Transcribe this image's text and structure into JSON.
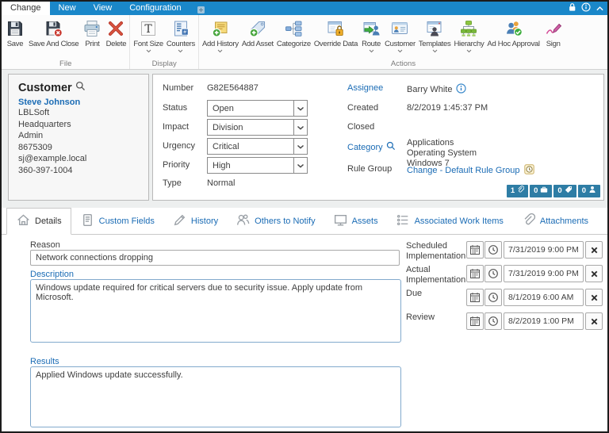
{
  "titlebar": {
    "tabs": [
      {
        "label": "Change"
      },
      {
        "label": "New"
      },
      {
        "label": "View"
      },
      {
        "label": "Configuration"
      }
    ]
  },
  "ribbon": {
    "groups": [
      {
        "label": "File",
        "buttons": [
          {
            "label": "Save",
            "icon": "save"
          },
          {
            "label": "Save And Close",
            "icon": "save-and-close"
          },
          {
            "label": "Print",
            "icon": "print"
          },
          {
            "label": "Delete",
            "icon": "delete"
          }
        ]
      },
      {
        "label": "Display",
        "buttons": [
          {
            "label": "Font Size",
            "icon": "font-size",
            "dropdown": true
          },
          {
            "label": "Counters",
            "icon": "counters",
            "dropdown": true
          }
        ]
      },
      {
        "label": "Actions",
        "buttons": [
          {
            "label": "Add History",
            "icon": "add-history",
            "dropdown": true
          },
          {
            "label": "Add Asset",
            "icon": "add-asset"
          },
          {
            "label": "Categorize",
            "icon": "categorize"
          },
          {
            "label": "Override Data",
            "icon": "override-data"
          },
          {
            "label": "Route",
            "icon": "route",
            "dropdown": true
          },
          {
            "label": "Customer",
            "icon": "customer",
            "dropdown": true
          },
          {
            "label": "Templates",
            "icon": "templates",
            "dropdown": true
          },
          {
            "label": "Hierarchy",
            "icon": "hierarchy",
            "dropdown": true
          },
          {
            "label": "Ad Hoc Approval",
            "icon": "ad-hoc-approval"
          },
          {
            "label": "Sign",
            "icon": "sign"
          }
        ]
      }
    ]
  },
  "customer_panel": {
    "title": "Customer",
    "name": "Steve Johnson",
    "lines": [
      "LBLSoft",
      "Headquarters",
      "Admin",
      "8675309",
      "sj@example.local",
      "360-397-1004"
    ]
  },
  "work_item": {
    "number_label": "Number",
    "number": "G82E564887",
    "status_label": "Status",
    "status": "Open",
    "impact_label": "Impact",
    "impact": "Division",
    "urgency_label": "Urgency",
    "urgency": "Critical",
    "priority_label": "Priority",
    "priority": "High",
    "type_label": "Type",
    "type": "Normal",
    "assignee_label": "Assignee",
    "assignee": "Barry White",
    "created_label": "Created",
    "created": "8/2/2019 1:45:37 PM",
    "closed_label": "Closed",
    "closed": "",
    "category_label": "Category",
    "category_lines": [
      "Applications",
      "Operating System",
      "Windows 7"
    ],
    "rule_group_label": "Rule Group",
    "rule_group": "Change - Default Rule Group",
    "badges": [
      {
        "count": "1",
        "icon": "paperclip"
      },
      {
        "count": "0",
        "icon": "briefcase"
      },
      {
        "count": "0",
        "icon": "tag"
      },
      {
        "count": "0",
        "icon": "person"
      }
    ]
  },
  "tabs": [
    {
      "label": "Details",
      "icon": "home",
      "active": true
    },
    {
      "label": "Custom Fields",
      "icon": "document"
    },
    {
      "label": "History",
      "icon": "pencil"
    },
    {
      "label": "Others to Notify",
      "icon": "people"
    },
    {
      "label": "Assets",
      "icon": "monitor"
    },
    {
      "label": "Associated Work Items",
      "icon": "list"
    },
    {
      "label": "Attachments",
      "icon": "paperclip"
    }
  ],
  "details": {
    "reason_label": "Reason",
    "reason_value": "Network connections dropping",
    "description_label": "Description",
    "description_value": "Windows update required for critical servers due to security issue. Apply update from Microsoft.",
    "results_label": "Results",
    "results_value": "Applied Windows update successfully.",
    "dates": [
      {
        "label": "Scheduled Implementation",
        "value": "7/31/2019 9:00 PM"
      },
      {
        "label": "Actual Implementation",
        "value": "7/31/2019 9:00 PM"
      },
      {
        "label": "Due",
        "value": "8/1/2019 6:00 AM"
      },
      {
        "label": "Review",
        "value": "8/2/2019 1:00 PM"
      }
    ]
  }
}
